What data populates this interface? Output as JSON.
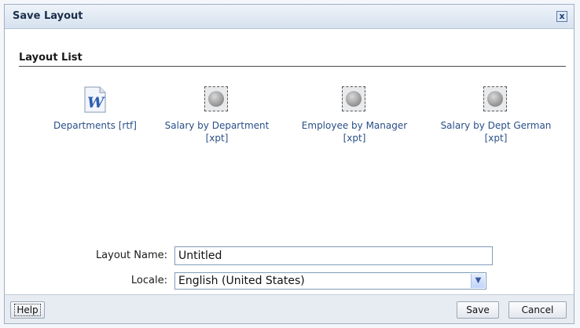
{
  "dialog": {
    "title": "Save Layout",
    "close_label": "x"
  },
  "layout_list": {
    "heading": "Layout List",
    "items": [
      {
        "label": "Departments [rtf]",
        "icon": "word-document-icon"
      },
      {
        "label": "Salary by Department [xpt]",
        "icon": "globe-icon"
      },
      {
        "label": "Employee by Manager [xpt]",
        "icon": "globe-icon"
      },
      {
        "label": "Salary by Dept German [xpt]",
        "icon": "globe-icon"
      }
    ]
  },
  "form": {
    "layout_name_label": "Layout Name:",
    "layout_name_value": "Untitled",
    "locale_label": "Locale:",
    "locale_value": "English (United States)"
  },
  "footer": {
    "help_label": "Help",
    "save_label": "Save",
    "cancel_label": "Cancel"
  },
  "colors": {
    "link": "#2a4f87",
    "titlebar": "#d6e2ef"
  }
}
